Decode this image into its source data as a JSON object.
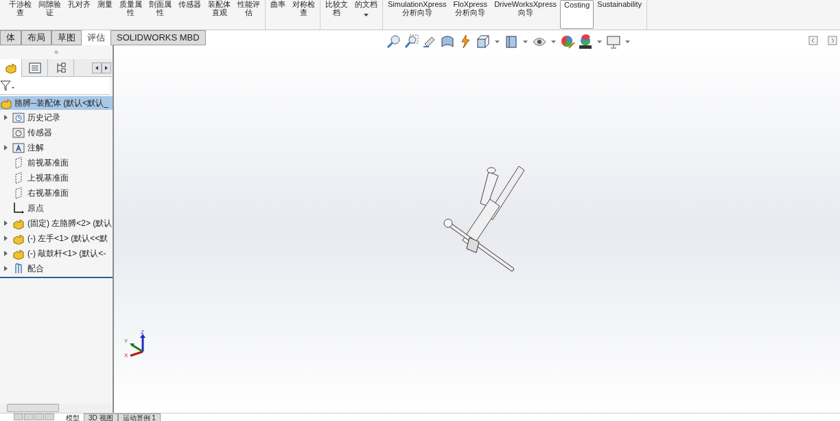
{
  "ribbon": {
    "groups": [
      {
        "buttons": [
          {
            "lines": [
              "干涉检",
              "查"
            ],
            "selected": false
          },
          {
            "lines": [
              "间隙验",
              "证"
            ],
            "selected": false
          },
          {
            "lines": [
              "孔对齐"
            ],
            "selected": false
          },
          {
            "lines": [
              "测量"
            ],
            "selected": false
          },
          {
            "lines": [
              "质量属",
              "性"
            ],
            "selected": false
          },
          {
            "lines": [
              "剖面属",
              "性"
            ],
            "selected": false
          },
          {
            "lines": [
              "传感器"
            ],
            "selected": false
          },
          {
            "lines": [
              "装配体",
              "直观"
            ],
            "selected": false
          },
          {
            "lines": [
              "性能评",
              "估"
            ],
            "selected": false
          }
        ]
      },
      {
        "buttons": [
          {
            "lines": [
              "曲率"
            ],
            "selected": false
          },
          {
            "lines": [
              "对称检",
              "查"
            ],
            "selected": false
          }
        ]
      },
      {
        "buttons": [
          {
            "lines": [
              "比较文",
              "档"
            ],
            "selected": false
          },
          {
            "lines": [
              "的文档"
            ],
            "selected": false,
            "dropdown": true
          }
        ]
      },
      {
        "buttons": [
          {
            "lines": [
              "SimulationXpress",
              "分析向导"
            ],
            "selected": false
          },
          {
            "lines": [
              "FloXpress",
              "分析向导"
            ],
            "selected": false
          },
          {
            "lines": [
              "DriveWorksXpress",
              "向导"
            ],
            "selected": false
          },
          {
            "lines": [
              "Costing"
            ],
            "selected": true
          },
          {
            "lines": [
              "Sustainability"
            ],
            "selected": false
          }
        ]
      }
    ]
  },
  "command_tabs": [
    {
      "label": "体",
      "selected": false
    },
    {
      "label": "布局",
      "selected": false
    },
    {
      "label": "草图",
      "selected": false
    },
    {
      "label": "评估",
      "selected": true
    },
    {
      "label": "SOLIDWORKS MBD",
      "selected": false
    }
  ],
  "tree": {
    "root": {
      "label": "胳膊--装配体  (默认<默认_",
      "selected": true
    },
    "items": [
      {
        "kind": "history",
        "label": "历史记录",
        "expander": true
      },
      {
        "kind": "sensor",
        "label": "传感器",
        "expander": false
      },
      {
        "kind": "annotation",
        "label": "注解",
        "expander": true
      },
      {
        "kind": "plane",
        "label": "前视基准面",
        "expander": false
      },
      {
        "kind": "plane",
        "label": "上视基准面",
        "expander": false
      },
      {
        "kind": "plane",
        "label": "右视基准面",
        "expander": false
      },
      {
        "kind": "origin",
        "label": "原点",
        "expander": false
      },
      {
        "kind": "part",
        "label": "(固定) 左胳膊<2> (默认",
        "expander": true
      },
      {
        "kind": "part",
        "label": "(-) 左手<1> (默认<<默",
        "expander": true
      },
      {
        "kind": "part",
        "label": "(-) 敲鼓杆<1> (默认<-",
        "expander": true
      },
      {
        "kind": "mates",
        "label": "配合",
        "expander": true
      }
    ]
  },
  "triad": {
    "x": "X",
    "y": "Y",
    "z": "Z"
  },
  "bottom_tabs": [
    {
      "label": "模型",
      "selected": true
    },
    {
      "label": "3D 视图",
      "selected": false
    },
    {
      "label": "运动算例 1",
      "selected": false
    }
  ]
}
